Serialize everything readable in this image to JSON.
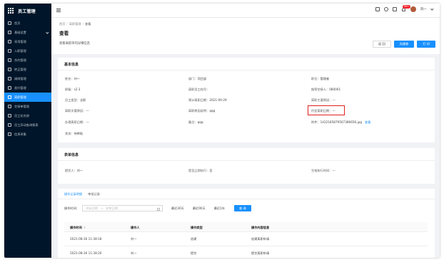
{
  "app": {
    "title": "员工管理"
  },
  "sidebar": {
    "items": [
      {
        "label": "首页",
        "icon": "home-icon",
        "caret": false,
        "active": false
      },
      {
        "label": "基础设置",
        "icon": "settings-icon",
        "caret": true,
        "active": false
      },
      {
        "label": "采用管理",
        "icon": "hire-icon",
        "caret": false,
        "active": false
      },
      {
        "label": "入职管理",
        "icon": "onboard-icon",
        "caret": false,
        "active": false
      },
      {
        "label": "合约管理",
        "icon": "contract-icon",
        "caret": false,
        "active": false
      },
      {
        "label": "转正管理",
        "icon": "regular-icon",
        "caret": false,
        "active": false
      },
      {
        "label": "调岗管理",
        "icon": "transfer-icon",
        "caret": false,
        "active": false
      },
      {
        "label": "晋升管理",
        "icon": "promotion-icon",
        "caret": false,
        "active": false
      },
      {
        "label": "离职管理",
        "icon": "resign-icon",
        "caret": false,
        "active": true
      },
      {
        "label": "交接单管理",
        "icon": "handover-icon",
        "caret": false,
        "active": false
      },
      {
        "label": "员工花名册",
        "icon": "roster-icon",
        "caret": false,
        "active": false
      },
      {
        "label": "员工异动查询报表",
        "icon": "report-icon",
        "caret": false,
        "active": false
      },
      {
        "label": "信息采集",
        "icon": "collect-icon",
        "caret": false,
        "active": false
      }
    ]
  },
  "topbar": {
    "badge": "99+",
    "user_name": "刘一"
  },
  "header": {
    "breadcrumb": [
      "首页",
      "离职管理",
      "查看"
    ],
    "title": "查看",
    "description": "查看离职单的详细信息",
    "buttons": {
      "back": "返 回",
      "log": "沟通卷",
      "print": "打 印"
    }
  },
  "basic": {
    "title": "基本信息",
    "fields": [
      {
        "label": "姓名：",
        "value": "刘一"
      },
      {
        "label": "部门：",
        "value": "项目部"
      },
      {
        "label": "职位：",
        "value": "管理者"
      },
      {
        "label": "职级：",
        "value": "s2.3"
      },
      {
        "label": "离职员工档号：",
        "value": ""
      },
      {
        "label": "推荐交接人：",
        "value": "080001"
      },
      {
        "label": "员工类型：",
        "value": "全职"
      },
      {
        "label": "预计离职日期：",
        "value": "2021-09-29"
      },
      {
        "label": "离职主要原因：",
        "value": "---"
      },
      {
        "label": "离职次要原因：",
        "value": "---"
      },
      {
        "label": "离职原因说明：",
        "value": "qqq"
      },
      {
        "label": "约定离职日期：",
        "value": "---"
      },
      {
        "label": "办理离职日期：",
        "value": "---"
      },
      {
        "label": "备注：",
        "value": "qqq"
      },
      {
        "label": "附件：",
        "value": "1432185879507386656.jpg",
        "link": "查看"
      },
      {
        "label": "状态：",
        "value": "待审批"
      }
    ]
  },
  "form": {
    "title": "表单信息",
    "fields": [
      {
        "label": "提交人：",
        "value": "刘一"
      },
      {
        "label": "是否立即执行：",
        "value": "否"
      },
      {
        "label": "生效执行时间：",
        "value": "---"
      }
    ]
  },
  "records": {
    "tabs": [
      "操作记录明细",
      "审批记录"
    ],
    "filter": {
      "label": "操作时间：",
      "start_placeholder": "开始日期",
      "end_placeholder": "结束日期",
      "arrow": "→",
      "quick": [
        "最近30天",
        "最近90天",
        "最近1年"
      ],
      "query": "查 询"
    },
    "columns": [
      "操作时间",
      "操作人",
      "操作类型",
      "操作内容信息"
    ],
    "sort_glyph": "⇕",
    "rows": [
      [
        "2021-08-30 11:38:18",
        "刘一",
        "创建",
        "创建离职申请"
      ],
      [
        "2021-08-30 11:38:20",
        "刘一",
        "提交",
        "提交离职申请"
      ]
    ]
  }
}
